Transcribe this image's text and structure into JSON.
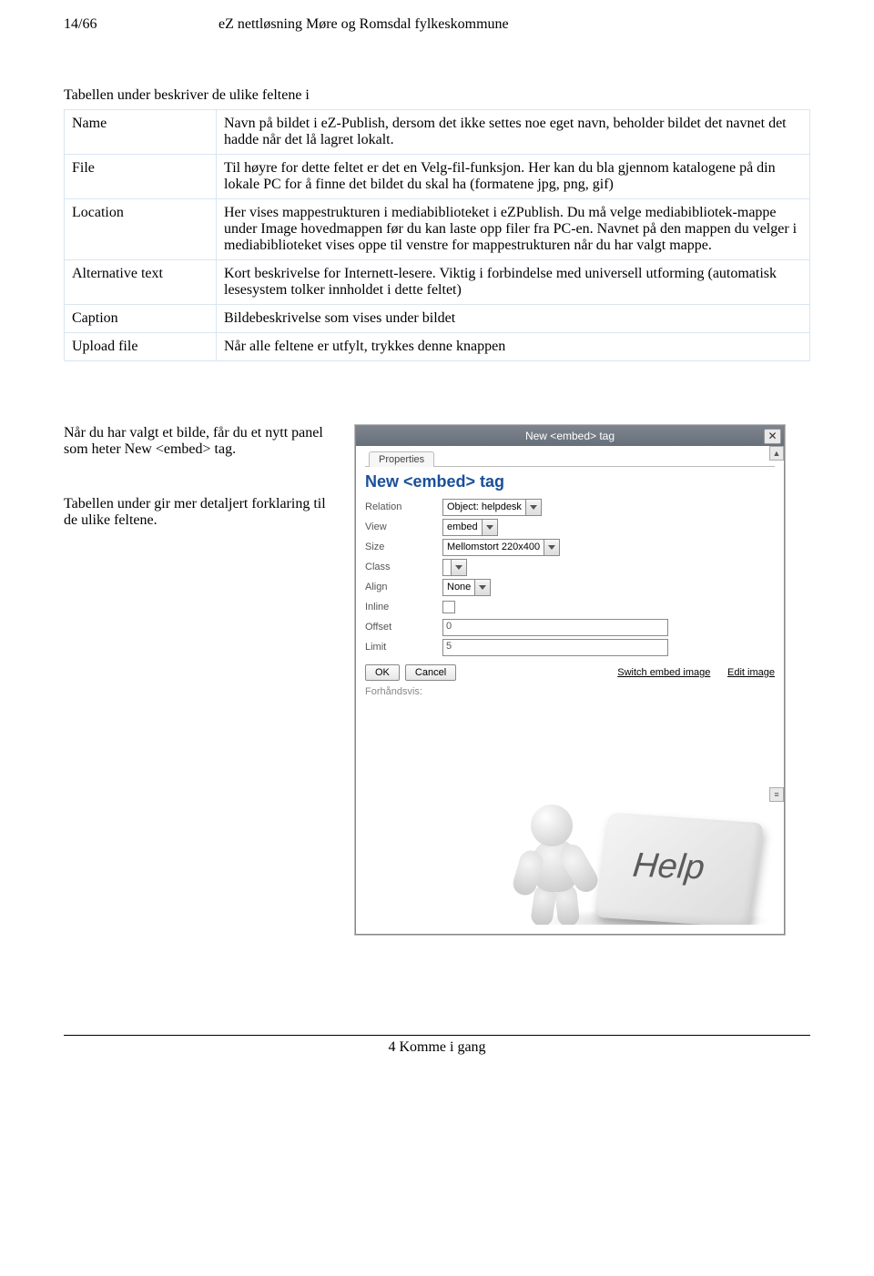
{
  "header": {
    "page_indicator": "14/66",
    "doc_title": "eZ nettløsning Møre og Romsdal fylkeskommune"
  },
  "intro": "Tabellen under beskriver de ulike feltene i",
  "table_rows": [
    {
      "label": "Name",
      "desc": "Navn på bildet i eZ-Publish, dersom det ikke settes noe eget navn, beholder bildet det navnet det hadde når det lå lagret lokalt."
    },
    {
      "label": "File",
      "desc": "Til høyre for dette feltet er det en Velg-fil-funksjon. Her kan du bla gjennom katalogene på din lokale PC for å finne det bildet du skal ha (formatene jpg, png, gif)"
    },
    {
      "label": "Location",
      "desc": "Her vises mappestrukturen i mediabiblioteket i eZPublish. Du må velge mediabibliotek-mappe under Image hovedmappen før du kan laste opp filer fra PC-en. Navnet på den mappen du velger i mediabiblioteket vises oppe til venstre for mappestrukturen når du har valgt mappe."
    },
    {
      "label": "Alternative text",
      "desc": "Kort beskrivelse for Internett-lesere. Viktig i forbindelse med universell utforming (automatisk lesesystem tolker innholdet i dette feltet)"
    },
    {
      "label": "Caption",
      "desc": "Bildebeskrivelse som vises under bildet"
    },
    {
      "label": "Upload file",
      "desc": "Når alle feltene er utfylt, trykkes denne knappen"
    }
  ],
  "paragraphs": {
    "p1": "Når du har valgt et bilde, får du et nytt panel som heter New <embed> tag.",
    "p2": "Tabellen under gir mer detaljert forklaring til de ulike feltene."
  },
  "dialog": {
    "title": "New <embed> tag",
    "tab": "Properties",
    "heading": "New <embed> tag",
    "rows": {
      "relation": {
        "label": "Relation",
        "value": "Object: helpdesk"
      },
      "view": {
        "label": "View",
        "value": "embed"
      },
      "size": {
        "label": "Size",
        "value": "Mellomstort 220x400"
      },
      "class": {
        "label": "Class",
        "value": ""
      },
      "align": {
        "label": "Align",
        "value": "None"
      },
      "inline": {
        "label": "Inline"
      },
      "offset": {
        "label": "Offset",
        "value": "0"
      },
      "limit": {
        "label": "Limit",
        "value": "5"
      }
    },
    "buttons": {
      "ok": "OK",
      "cancel": "Cancel"
    },
    "links": {
      "switch": "Switch embed image",
      "edit": "Edit image"
    },
    "preview_label": "Forhåndsvis:",
    "help_text": "Help"
  },
  "footer": "4 Komme i gang"
}
